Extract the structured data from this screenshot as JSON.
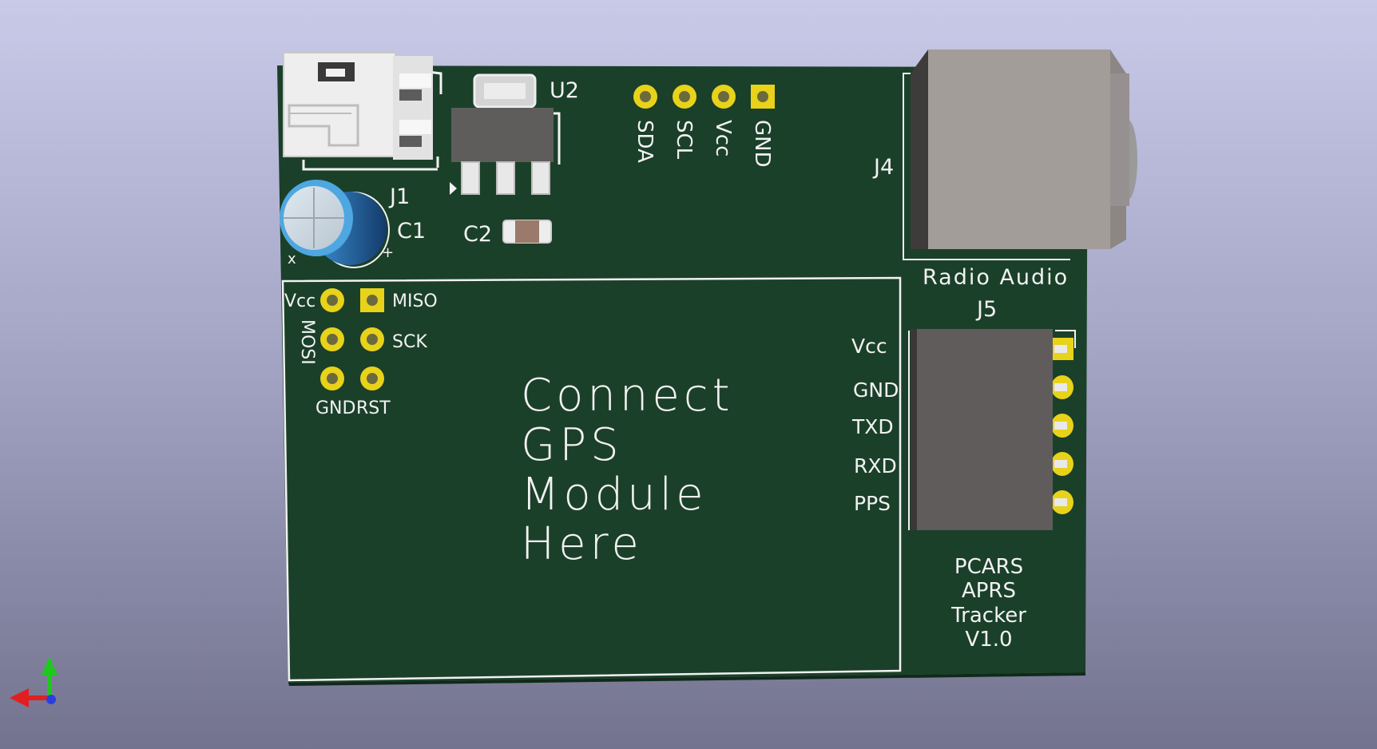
{
  "viewer": {
    "background_top": "#c9c9e8",
    "background_bottom": "#73738f",
    "board_color": "#1b4029",
    "silkscreen_color": "#f2f2f2",
    "pad_color": "#e8d21a"
  },
  "components": {
    "j1": "J1",
    "c1": "C1",
    "u2": "U2",
    "c2": "C2",
    "j4": "J4",
    "j5": "J5"
  },
  "i2c_header": [
    "SDA",
    "SCL",
    "Vcc",
    "GND"
  ],
  "jack_label": "Radio Audio",
  "isp_header": {
    "vcc": "Vcc",
    "miso": "MISO",
    "mosi": "MOSI",
    "sck": "SCK",
    "gnd": "GND",
    "rst": "RST"
  },
  "gps_area": {
    "line1": "Connect",
    "line2": "GPS",
    "line3": "Module",
    "line4": "Here"
  },
  "gps_pins": [
    "Vcc",
    "GND",
    "TXD",
    "RXD",
    "PPS"
  ],
  "board_title": {
    "line1": "PCARS",
    "line2": "APRS",
    "line3": "Tracker",
    "line4": "V1.0"
  },
  "axes_gizmo": {
    "x_color": "#e02020",
    "y_color": "#1fc81f",
    "z_color": "#2a3fe0"
  }
}
